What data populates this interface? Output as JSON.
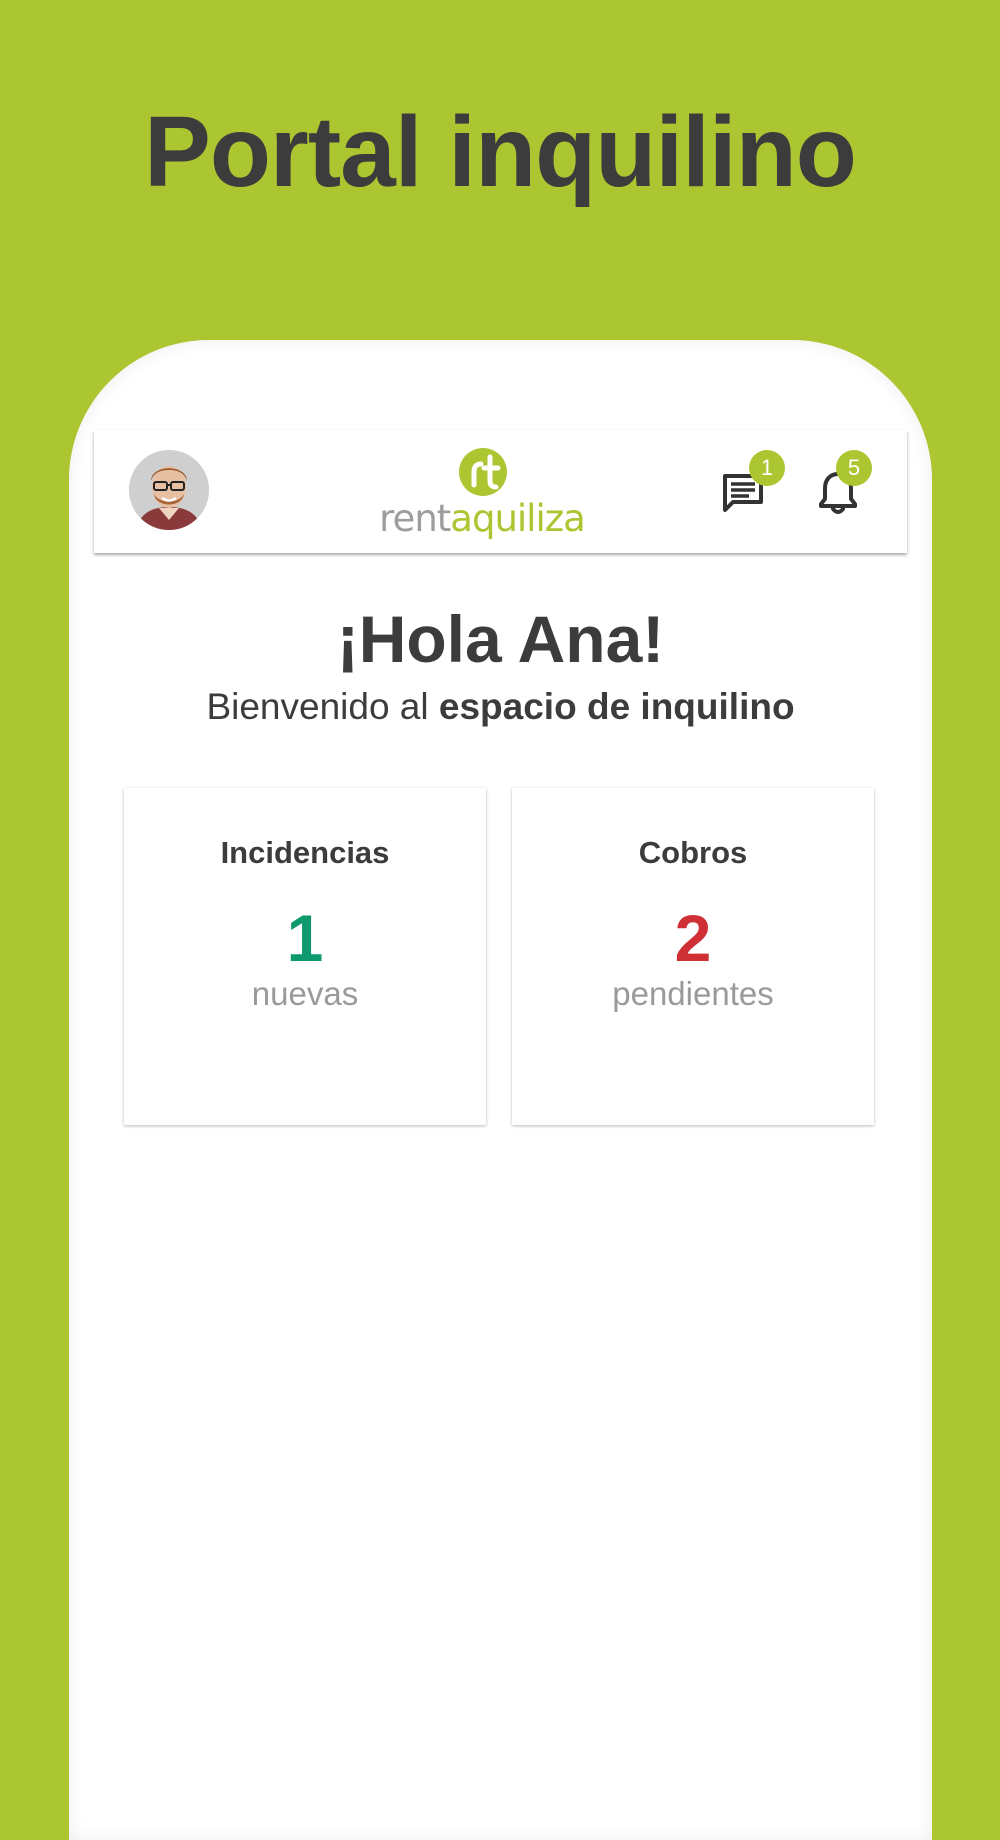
{
  "headline": "Portal inquilino",
  "app_bar": {
    "logo_text_part1": "rent",
    "logo_text_part2": "aquiliza",
    "messages_badge": "1",
    "notifications_badge": "5"
  },
  "greeting": {
    "title": "¡Hola Ana!",
    "subtitle_prefix": "Bienvenido al ",
    "subtitle_bold": "espacio de inquilino"
  },
  "cards": [
    {
      "title": "Incidencias",
      "value": "1",
      "caption": "nuevas",
      "value_color": "#0e9a6e"
    },
    {
      "title": "Cobros",
      "value": "2",
      "caption": "pendientes",
      "value_color": "#cf3035"
    }
  ],
  "colors": {
    "background": "#acc632",
    "brand_green": "#acc632",
    "text_dark": "#3c3c3c",
    "logo_gray": "#9d9d9d"
  },
  "icons": {
    "messages": "message-lines-icon",
    "notifications": "bell-icon",
    "avatar": "user-avatar"
  }
}
